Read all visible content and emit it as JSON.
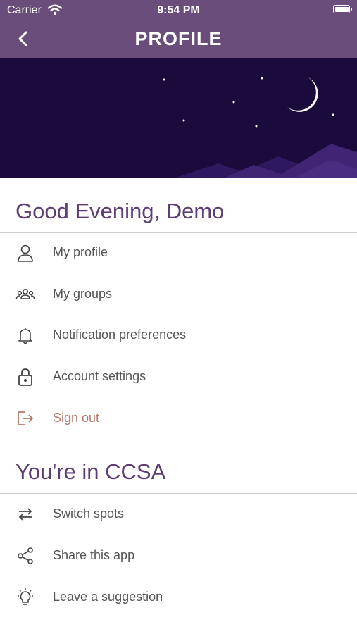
{
  "status_bar": {
    "carrier": "Carrier",
    "time": "9:54 PM"
  },
  "nav": {
    "title": "PROFILE",
    "back_icon": "chevron-left-icon"
  },
  "banner": {
    "theme": "night-sky",
    "colors": {
      "sky": "#1b0a3c",
      "mountains": "#3a2070",
      "moon": "#ffffff"
    }
  },
  "greeting": "Good Evening, Demo",
  "account_menu": [
    {
      "label": "My profile",
      "icon": "user-icon"
    },
    {
      "label": "My groups",
      "icon": "group-icon"
    },
    {
      "label": "Notification preferences",
      "icon": "bell-icon"
    },
    {
      "label": "Account settings",
      "icon": "lock-icon"
    },
    {
      "label": "Sign out",
      "icon": "sign-out-icon"
    }
  ],
  "community_section": {
    "title": "You're in CCSA"
  },
  "community_menu": [
    {
      "label": "Switch spots",
      "icon": "swap-arrows-icon"
    },
    {
      "label": "Share this app",
      "icon": "share-icon"
    },
    {
      "label": "Leave a suggestion",
      "icon": "lightbulb-icon"
    }
  ],
  "colors": {
    "header": "#6b4d7b",
    "heading_text": "#5d3d73",
    "item_text": "#555555",
    "sign_out": "#b07a6a"
  }
}
